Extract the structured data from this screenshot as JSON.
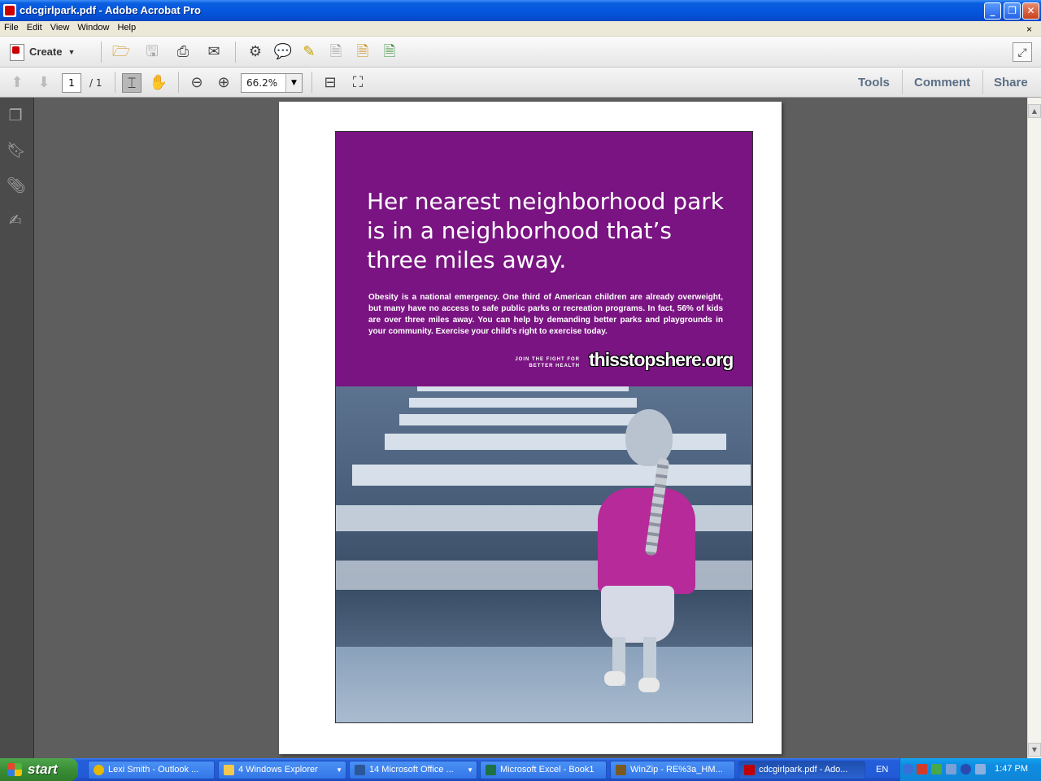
{
  "window": {
    "title": "cdcgirlpark.pdf - Adobe Acrobat Pro",
    "min": "_",
    "max": "❐",
    "close": "✕"
  },
  "menu": [
    "File",
    "Edit",
    "View",
    "Window",
    "Help"
  ],
  "menu_close": "×",
  "toolbar": {
    "create_label": "Create",
    "page_current": "1",
    "page_total": "/ 1",
    "zoom": "66.2%",
    "tabs": [
      "Tools",
      "Comment",
      "Share"
    ]
  },
  "document": {
    "headline": "Her nearest neighborhood park is in a neighborhood that’s three miles away.",
    "body": "Obesity is a national emergency. One third of American children are already overweight, but many have no access to safe public parks or recreation programs. In fact, 56% of kids are over three miles away. You can help by demanding better parks and playgrounds in your community. Exercise your child’s right to exercise today.",
    "join_line1": "JOIN THE FIGHT FOR",
    "join_line2": "BETTER HEALTH",
    "brand": "thisstopshere.org"
  },
  "taskbar": {
    "start": "start",
    "tasks": [
      {
        "label": "Lexi Smith - Outlook ...",
        "color": "#e6b800"
      },
      {
        "label": "4 Windows Explorer",
        "color": "#f2c94c"
      },
      {
        "label": "14 Microsoft Office ...",
        "color": "#2b5797"
      },
      {
        "label": "Microsoft Excel - Book1",
        "color": "#1e7145"
      },
      {
        "label": "WinZip - RE%3a_HM...",
        "color": "#7a5a1e"
      },
      {
        "label": "cdcgirlpark.pdf - Ado...",
        "color": "#c00000"
      }
    ],
    "language": "EN",
    "clock": "1:47 PM"
  },
  "colors": {
    "poster_purple": "#7a1482",
    "accent": "#0455dc"
  }
}
